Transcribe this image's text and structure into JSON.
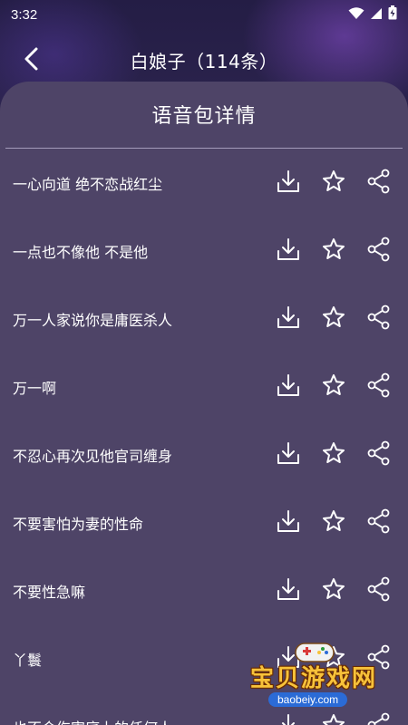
{
  "status_bar": {
    "time": "3:32",
    "icons": [
      "wifi-icon",
      "signal-icon",
      "battery-icon"
    ]
  },
  "header": {
    "back_icon": "chevron-left-icon",
    "title": "白娘子（114条）"
  },
  "panel": {
    "title": "语音包详情"
  },
  "list": {
    "items": [
      {
        "label": "一心向道 绝不恋战红尘"
      },
      {
        "label": "一点也不像他 不是他"
      },
      {
        "label": "万一人家说你是庸医杀人"
      },
      {
        "label": "万一啊"
      },
      {
        "label": "不忍心再次见他官司缠身"
      },
      {
        "label": "不要害怕为妻的性命"
      },
      {
        "label": "不要性急嘛"
      },
      {
        "label": "丫鬟"
      },
      {
        "label": "也不会伤害底上的任何人"
      }
    ],
    "action_icons": [
      "download-icon",
      "star-icon",
      "share-icon"
    ]
  },
  "watermark": {
    "text": "宝贝游戏网",
    "url": "baobeiy.com"
  },
  "colors": {
    "panel": "#4e4467",
    "background": "#2b234d",
    "text": "#ffffff",
    "divider": "#a49cba"
  }
}
